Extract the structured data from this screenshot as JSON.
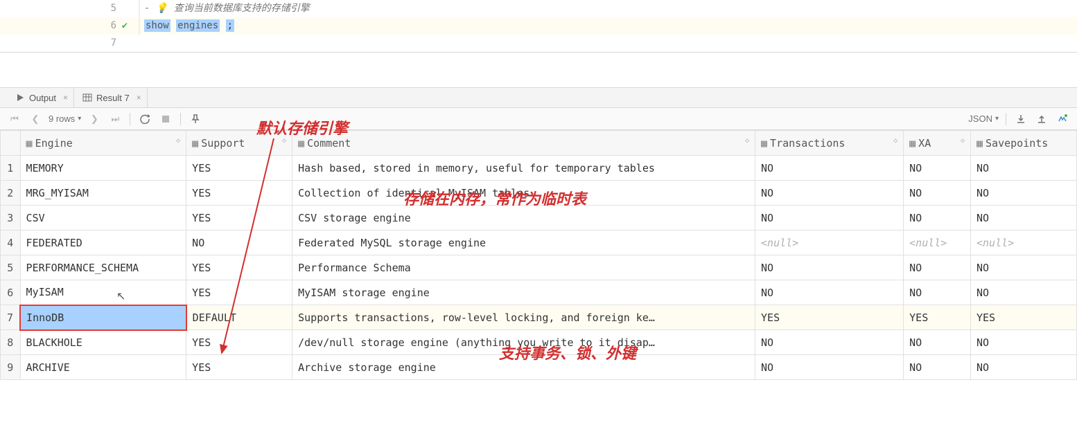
{
  "editor": {
    "lines": {
      "l5_num": "5",
      "l5_code": "查询当前数据库支持的存储引擎",
      "l5_prefix": "-",
      "l6_num": "6",
      "l6_code_show": "show",
      "l6_code_engines": "engines",
      "l6_semi": ";",
      "l7_num": "7"
    }
  },
  "tabs": {
    "output": "Output",
    "result": "Result 7"
  },
  "toolbar": {
    "rows": "9 rows",
    "json": "JSON"
  },
  "columns": {
    "engine": "Engine",
    "support": "Support",
    "comment": "Comment",
    "transactions": "Transactions",
    "xa": "XA",
    "savepoints": "Savepoints"
  },
  "rows": [
    {
      "n": "1",
      "engine": "MEMORY",
      "support": "YES",
      "comment": "Hash based, stored in memory, useful for temporary tables",
      "trans": "NO",
      "xa": "NO",
      "save": "NO"
    },
    {
      "n": "2",
      "engine": "MRG_MYISAM",
      "support": "YES",
      "comment": "Collection of identical MyISAM tables",
      "trans": "NO",
      "xa": "NO",
      "save": "NO"
    },
    {
      "n": "3",
      "engine": "CSV",
      "support": "YES",
      "comment": "CSV storage engine",
      "trans": "NO",
      "xa": "NO",
      "save": "NO"
    },
    {
      "n": "4",
      "engine": "FEDERATED",
      "support": "NO",
      "comment": "Federated MySQL storage engine",
      "trans": "<null>",
      "xa": "<null>",
      "save": "<null>"
    },
    {
      "n": "5",
      "engine": "PERFORMANCE_SCHEMA",
      "support": "YES",
      "comment": "Performance Schema",
      "trans": "NO",
      "xa": "NO",
      "save": "NO"
    },
    {
      "n": "6",
      "engine": "MyISAM",
      "support": "YES",
      "comment": "MyISAM storage engine",
      "trans": "NO",
      "xa": "NO",
      "save": "NO"
    },
    {
      "n": "7",
      "engine": "InnoDB",
      "support": "DEFAULT",
      "comment": "Supports transactions, row-level locking, and foreign ke…",
      "trans": "YES",
      "xa": "YES",
      "save": "YES"
    },
    {
      "n": "8",
      "engine": "BLACKHOLE",
      "support": "YES",
      "comment": "/dev/null storage engine (anything you write to it disap…",
      "trans": "NO",
      "xa": "NO",
      "save": "NO"
    },
    {
      "n": "9",
      "engine": "ARCHIVE",
      "support": "YES",
      "comment": "Archive storage engine",
      "trans": "NO",
      "xa": "NO",
      "save": "NO"
    }
  ],
  "annotations": {
    "a1": "默认存储引擎",
    "a2": "存储在内存，常作为临时表",
    "a3": "支持事务、锁、外键"
  },
  "null_label": "<null>",
  "selected_row_index": 6
}
